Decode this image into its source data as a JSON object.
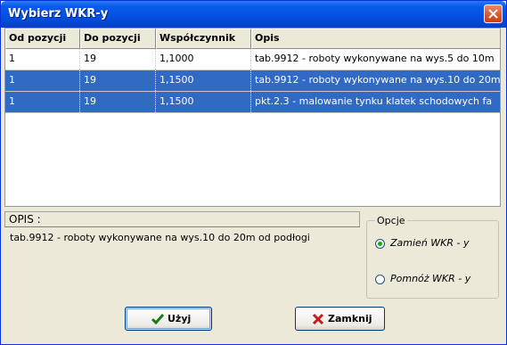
{
  "window": {
    "title": "Wybierz WKR-y",
    "close_icon": "close-icon"
  },
  "table": {
    "columns": [
      "Od pozycji",
      "Do pozycji",
      "Współczynnik",
      "Opis"
    ],
    "rows": [
      {
        "od": "1",
        "do": "19",
        "wsp": "1,1000",
        "opis": "tab.9912 - roboty wykonywane na wys.5 do 10m",
        "selected": false
      },
      {
        "od": "1",
        "do": "19",
        "wsp": "1,1500",
        "opis": "tab.9912 - roboty wykonywane na wys.10 do 20m",
        "selected": true
      },
      {
        "od": "1",
        "do": "19",
        "wsp": "1,1500",
        "opis": "pkt.2.3 - malowanie tynku klatek schodowych fa",
        "selected": true
      }
    ]
  },
  "opis": {
    "label": "OPIS :",
    "text": "tab.9912 - roboty wykonywane na wys.10 do 20m od podłogi"
  },
  "opcje": {
    "label": "Opcje",
    "options": [
      {
        "label": "Zamień WKR - y",
        "selected": true
      },
      {
        "label": "Pomnóż WKR - y",
        "selected": false
      }
    ]
  },
  "buttons": {
    "use": {
      "label": "Użyj",
      "icon": "checkmark-icon"
    },
    "close": {
      "label": "Zamknij",
      "icon": "x-icon"
    }
  },
  "colors": {
    "selection": "#316ac5",
    "title_bar": "#0450e0",
    "face": "#ece9d8"
  }
}
